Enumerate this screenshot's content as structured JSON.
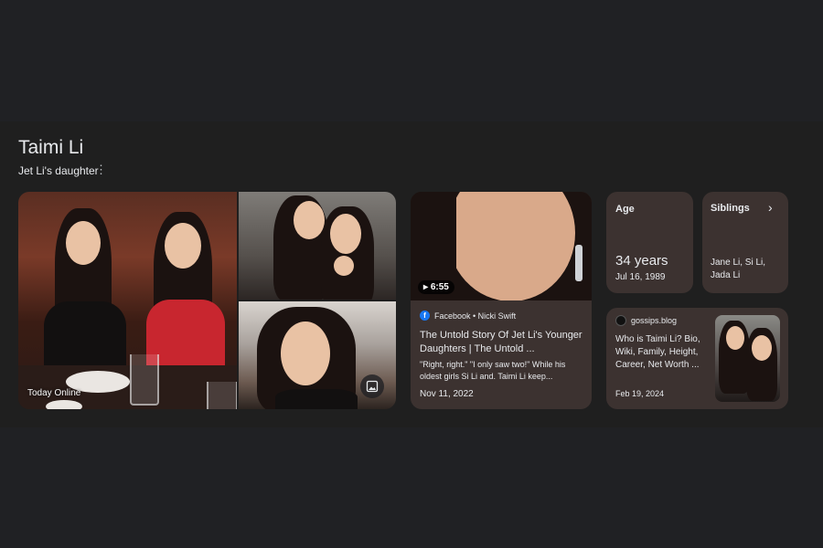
{
  "entity": {
    "name": "Taimi Li",
    "description": "Jet Li's daughter",
    "more_icon": "more-vert-icon"
  },
  "photos": {
    "main_caption": "Today Online",
    "image_button_icon": "image-icon"
  },
  "video": {
    "duration": "6:55",
    "source": "Facebook • Nicki Swift",
    "title": "The Untold Story Of Jet Li's Younger Daughters | The Untold ...",
    "snippet": "\"Right, right.\" \"I only saw two!\" While his oldest girls Si Li and. Taimi Li keep...",
    "date": "Nov 11, 2022"
  },
  "facts": {
    "age": {
      "label": "Age",
      "value": "34 years",
      "detail": "Jul 16, 1989"
    },
    "siblings": {
      "label": "Siblings",
      "value": "Jane Li, Si Li, Jada Li"
    }
  },
  "article": {
    "source": "gossips.blog",
    "title": "Who is Taimi Li? Bio, Wiki, Family, Height, Career, Net Worth ...",
    "date": "Feb 19, 2024"
  },
  "colors": {
    "background": "#202124",
    "panel": "#1f1f1f",
    "card": "#3c3230",
    "text": "#e8eaed"
  }
}
